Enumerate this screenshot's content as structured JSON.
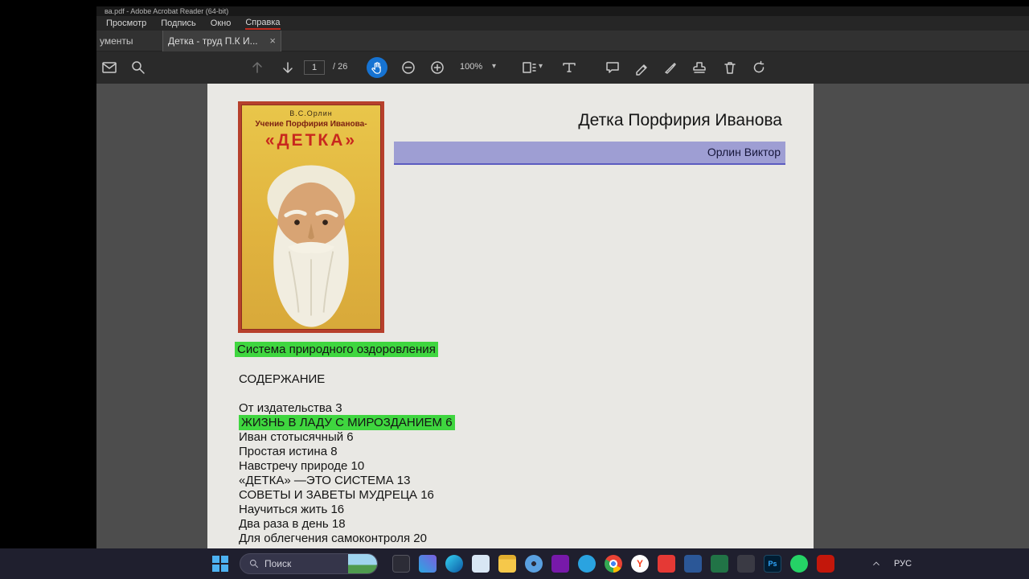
{
  "window": {
    "title": "ва.pdf - Adobe Acrobat Reader (64-bit)"
  },
  "menu": {
    "items": [
      "Просмотр",
      "Подпись",
      "Окно",
      "Справка"
    ]
  },
  "tabs": {
    "documents_partial": "ументы",
    "active_label": "Детка - труд П.К И...",
    "close_glyph": "×"
  },
  "toolbar": {
    "page_current": "1",
    "page_total": "/ 26",
    "zoom_level": "100%",
    "caret_glyph": "▾"
  },
  "document": {
    "cover": {
      "author_small": "В.С.Орлин",
      "series": "Учение Порфирия Иванова-",
      "title": "«ДЕТКА»"
    },
    "heading": "Детка Порфирия Иванова",
    "author_bar": "Орлин Виктор",
    "highlight_subtitle": "Система природного оздоровления",
    "contents_heading": "СОДЕРЖАНИЕ",
    "toc": [
      {
        "text": "От издательства 3",
        "highlight": false
      },
      {
        "text": "ЖИЗНЬ В ЛАДУ С МИРОЗДАНИЕМ 6",
        "highlight": true
      },
      {
        "text": "Иван стотысячный 6",
        "highlight": false
      },
      {
        "text": "Простая истина 8",
        "highlight": false
      },
      {
        "text": "Навстречу природе 10",
        "highlight": false
      },
      {
        "text": "«ДЕТКА» —ЭТО СИСТЕМА 13",
        "highlight": false
      },
      {
        "text": "СОВЕТЫ И ЗАВЕТЫ МУДРЕЦА 16",
        "highlight": false
      },
      {
        "text": "Научиться жить 16",
        "highlight": false
      },
      {
        "text": "Два раза в день 18",
        "highlight": false
      },
      {
        "text": "Для облегчения самоконтроля 20",
        "highlight": false
      }
    ]
  },
  "taskbar": {
    "search_placeholder": "Поиск",
    "language": "РУС",
    "icons": [
      {
        "name": "taskview",
        "glyph": ""
      },
      {
        "name": "photos",
        "glyph": ""
      },
      {
        "name": "edge",
        "glyph": ""
      },
      {
        "name": "mail",
        "glyph": ""
      },
      {
        "name": "folder",
        "glyph": ""
      },
      {
        "name": "settings",
        "glyph": ""
      },
      {
        "name": "onenote",
        "glyph": ""
      },
      {
        "name": "telegram",
        "glyph": ""
      },
      {
        "name": "chrome",
        "glyph": ""
      },
      {
        "name": "yandex",
        "glyph": "Y"
      },
      {
        "name": "redapp",
        "glyph": ""
      },
      {
        "name": "word",
        "glyph": ""
      },
      {
        "name": "excel",
        "glyph": ""
      },
      {
        "name": "darkapp",
        "glyph": ""
      },
      {
        "name": "photoshop",
        "glyph": "Ps"
      },
      {
        "name": "whatsapp",
        "glyph": ""
      },
      {
        "name": "acrobat",
        "glyph": ""
      }
    ]
  },
  "colors": {
    "highlight_green": "#3fd63f",
    "highlight_purple": "#9e9ed3",
    "tool_active_blue": "#1673d2"
  }
}
